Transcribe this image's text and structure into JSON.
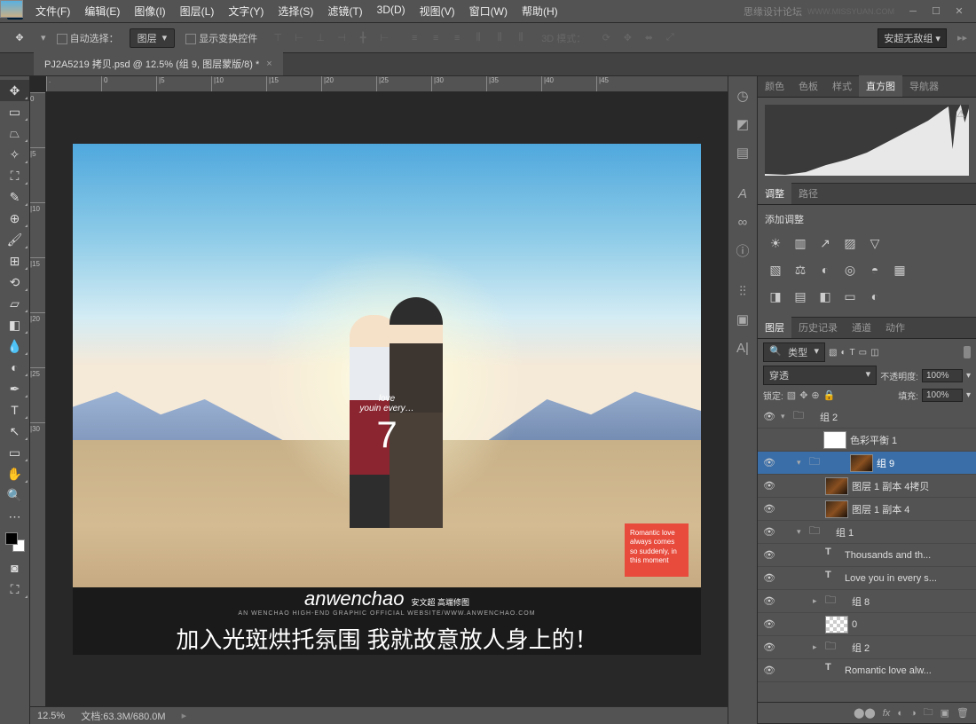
{
  "app": "Ps",
  "menu": [
    "文件(F)",
    "编辑(E)",
    "图像(I)",
    "图层(L)",
    "文字(Y)",
    "选择(S)",
    "滤镜(T)",
    "3D(D)",
    "视图(V)",
    "窗口(W)",
    "帮助(H)"
  ],
  "watermark": "思缘设计论坛",
  "watermark_url": "WWW.MISSYUAN.COM",
  "options": {
    "auto_select": "自动选择：",
    "target": "图层",
    "show_transform": "显示变换控件",
    "mode_label": "3D 模式：",
    "workspace": "安超无敌组"
  },
  "tab_title": "PJ2A5219 拷贝.psd @ 12.5% (组 9, 图层蒙版/8) *",
  "ruler_h": [
    ".",
    "0",
    "|5",
    "|10",
    "|15",
    "|20",
    "|25",
    "|30",
    "|35",
    "|40",
    "|45"
  ],
  "ruler_v": [
    "0",
    "|5",
    "|10",
    "|15",
    "|20",
    "|25",
    "|30"
  ],
  "image": {
    "overlay_script": "love",
    "overlay_line": "youin every…",
    "overlay_num": "7",
    "red_box": "Romantic love always comes so suddenly, in this moment",
    "brand": "anwenchao",
    "brand_cn": "安文超 高端修图",
    "brand_url": "AN WENCHAO HIGH-END GRAPHIC  OFFICIAL WEBSITE/WWW.ANWENCHAO.COM",
    "caption": "加入光斑烘托氛围   我就故意放人身上的！"
  },
  "status": {
    "zoom": "12.5%",
    "doc": "文档:63.3M/680.0M"
  },
  "panel_histogram_tabs": [
    "颜色",
    "色板",
    "样式",
    "直方图",
    "导航器"
  ],
  "panel_adjust_tabs": [
    "调整",
    "路径"
  ],
  "adjust_title": "添加调整",
  "panel_layers_tabs": [
    "图层",
    "历史记录",
    "通道",
    "动作"
  ],
  "layers": {
    "filter_kind": "类型",
    "blend": "穿透",
    "opacity_label": "不透明度:",
    "opacity": "100%",
    "lock_label": "锁定:",
    "fill_label": "填充:",
    "fill": "100%",
    "items": [
      {
        "eye": true,
        "indent": 0,
        "chev": "▾",
        "type": "folder",
        "name": "组 2"
      },
      {
        "eye": false,
        "indent": 1,
        "type": "adj",
        "mask": true,
        "name": "色彩平衡 1",
        "adjthumb": "sky"
      },
      {
        "eye": true,
        "indent": 1,
        "sel": true,
        "chev": "▾",
        "type": "folder",
        "mask": true,
        "name": "组 9",
        "maskthumb": "img"
      },
      {
        "eye": true,
        "indent": 2,
        "type": "img",
        "name": "图层 1 副本 4拷贝"
      },
      {
        "eye": true,
        "indent": 2,
        "type": "img",
        "name": "图层 1 副本 4"
      },
      {
        "eye": true,
        "indent": 1,
        "chev": "▾",
        "type": "folder",
        "name": "组 1"
      },
      {
        "eye": true,
        "indent": 2,
        "type": "text",
        "name": "Thousands and th..."
      },
      {
        "eye": true,
        "indent": 2,
        "type": "text",
        "name": "Love you in every s..."
      },
      {
        "eye": true,
        "indent": 2,
        "chev": "▸",
        "type": "folder",
        "name": "组 8"
      },
      {
        "eye": true,
        "indent": 2,
        "type": "trans",
        "name": "0"
      },
      {
        "eye": true,
        "indent": 2,
        "chev": "▸",
        "type": "folder",
        "name": "组 2"
      },
      {
        "eye": true,
        "indent": 2,
        "type": "text",
        "name": "Romantic love  alw..."
      }
    ]
  }
}
